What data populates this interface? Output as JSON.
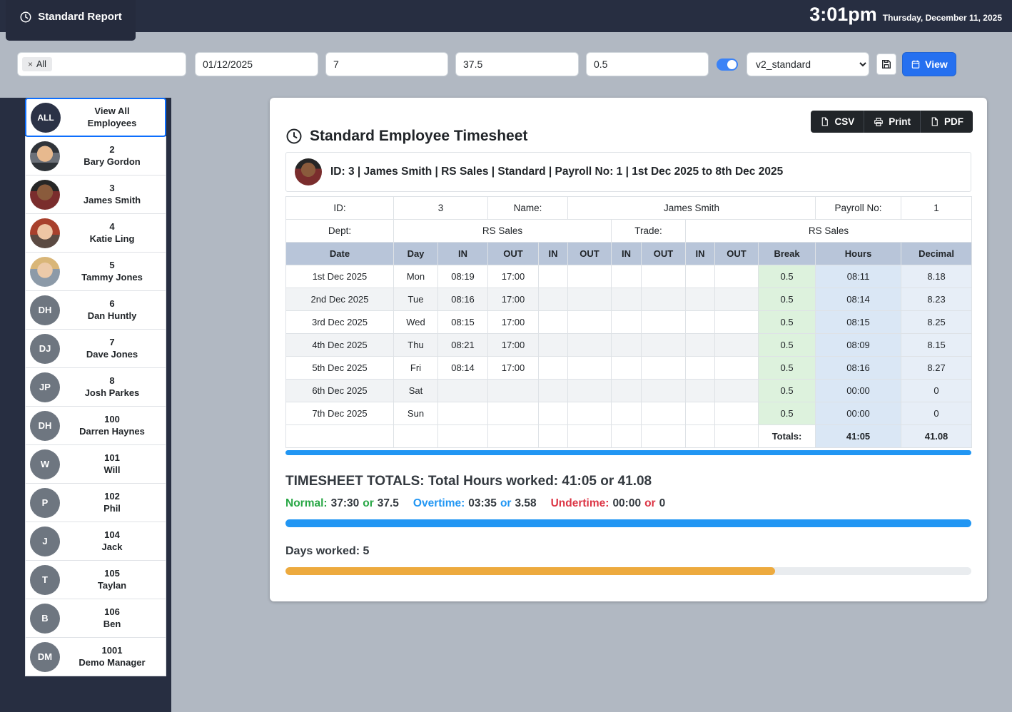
{
  "header": {
    "tab_label": "Standard Report",
    "time": "3:01pm",
    "date": "Thursday, December 11, 2025"
  },
  "filters": {
    "employee_filter_tag": "All",
    "tag_remove_glyph": "×",
    "start_date": "01/12/2025",
    "num_days": "7",
    "weekly_hours": "37.5",
    "break_hours": "0.5",
    "template_selected": "v2_standard",
    "view_button_label": "View"
  },
  "sidebar": {
    "items": [
      {
        "avatar": "ALL",
        "line1": "View All",
        "line2": "Employees",
        "selected": true
      },
      {
        "avatar": "",
        "line1": "2",
        "line2": "Bary Gordon"
      },
      {
        "avatar": "",
        "line1": "3",
        "line2": "James Smith"
      },
      {
        "avatar": "",
        "line1": "4",
        "line2": "Katie Ling"
      },
      {
        "avatar": "",
        "line1": "5",
        "line2": "Tammy Jones"
      },
      {
        "avatar": "DH",
        "line1": "6",
        "line2": "Dan Huntly"
      },
      {
        "avatar": "DJ",
        "line1": "7",
        "line2": "Dave Jones"
      },
      {
        "avatar": "JP",
        "line1": "8",
        "line2": "Josh Parkes"
      },
      {
        "avatar": "DH",
        "line1": "100",
        "line2": "Darren Haynes"
      },
      {
        "avatar": "W",
        "line1": "101",
        "line2": "Will"
      },
      {
        "avatar": "P",
        "line1": "102",
        "line2": "Phil"
      },
      {
        "avatar": "J",
        "line1": "104",
        "line2": "Jack"
      },
      {
        "avatar": "T",
        "line1": "105",
        "line2": "Taylan"
      },
      {
        "avatar": "B",
        "line1": "106",
        "line2": "Ben"
      },
      {
        "avatar": "DM",
        "line1": "1001",
        "line2": "Demo Manager"
      }
    ]
  },
  "report": {
    "export": {
      "csv": "CSV",
      "print": "Print",
      "pdf": "PDF"
    },
    "title": "Standard Employee Timesheet",
    "summary": "ID: 3 | James Smith | RS Sales | Standard | Payroll No: 1 | 1st Dec 2025 to 8th Dec 2025",
    "info": {
      "id_label": "ID:",
      "id": "3",
      "name_label": "Name:",
      "name": "James Smith",
      "payroll_label": "Payroll No:",
      "payroll": "1",
      "dept_label": "Dept:",
      "dept": "RS Sales",
      "trade_label": "Trade:",
      "trade": "RS Sales"
    },
    "table": {
      "headers": [
        "Date",
        "Day",
        "IN",
        "OUT",
        "IN",
        "OUT",
        "IN",
        "OUT",
        "IN",
        "OUT",
        "Break",
        "Hours",
        "Decimal"
      ],
      "rows": [
        {
          "date": "1st Dec 2025",
          "day": "Mon",
          "in1": "08:19",
          "out1": "17:00",
          "in2": "",
          "out2": "",
          "in3": "",
          "out3": "",
          "in4": "",
          "out4": "",
          "break": "0.5",
          "hours": "08:11",
          "decimal": "8.18"
        },
        {
          "date": "2nd Dec 2025",
          "day": "Tue",
          "in1": "08:16",
          "out1": "17:00",
          "in2": "",
          "out2": "",
          "in3": "",
          "out3": "",
          "in4": "",
          "out4": "",
          "break": "0.5",
          "hours": "08:14",
          "decimal": "8.23"
        },
        {
          "date": "3rd Dec 2025",
          "day": "Wed",
          "in1": "08:15",
          "out1": "17:00",
          "in2": "",
          "out2": "",
          "in3": "",
          "out3": "",
          "in4": "",
          "out4": "",
          "break": "0.5",
          "hours": "08:15",
          "decimal": "8.25"
        },
        {
          "date": "4th Dec 2025",
          "day": "Thu",
          "in1": "08:21",
          "out1": "17:00",
          "in2": "",
          "out2": "",
          "in3": "",
          "out3": "",
          "in4": "",
          "out4": "",
          "break": "0.5",
          "hours": "08:09",
          "decimal": "8.15"
        },
        {
          "date": "5th Dec 2025",
          "day": "Fri",
          "in1": "08:14",
          "out1": "17:00",
          "in2": "",
          "out2": "",
          "in3": "",
          "out3": "",
          "in4": "",
          "out4": "",
          "break": "0.5",
          "hours": "08:16",
          "decimal": "8.27"
        },
        {
          "date": "6th Dec 2025",
          "day": "Sat",
          "in1": "",
          "out1": "",
          "in2": "",
          "out2": "",
          "in3": "",
          "out3": "",
          "in4": "",
          "out4": "",
          "break": "0.5",
          "hours": "00:00",
          "decimal": "0"
        },
        {
          "date": "7th Dec 2025",
          "day": "Sun",
          "in1": "",
          "out1": "",
          "in2": "",
          "out2": "",
          "in3": "",
          "out3": "",
          "in4": "",
          "out4": "",
          "break": "0.5",
          "hours": "00:00",
          "decimal": "0"
        }
      ],
      "totals_label": "Totals:",
      "totals_hours": "41:05",
      "totals_decimal": "41.08"
    },
    "totals": {
      "heading": "TIMESHEET TOTALS: Total Hours worked: 41:05 or 41.08",
      "normal": {
        "label": "Normal:",
        "time": "37:30",
        "or": "or",
        "decimal": "37.5"
      },
      "overtime": {
        "label": "Overtime:",
        "time": "03:35",
        "or": "or",
        "decimal": "3.58"
      },
      "undertime": {
        "label": "Undertime:",
        "time": "00:00",
        "or": "or",
        "decimal": "0"
      },
      "days_label": "Days worked:",
      "days_value": "5",
      "days_total": 7
    },
    "colors": {
      "accent_blue": "#2196f3",
      "normal_green": "#28a745",
      "undertime_red": "#dc3545",
      "days_bar_orange": "#edaa3e",
      "header_navy": "#272e41"
    }
  }
}
